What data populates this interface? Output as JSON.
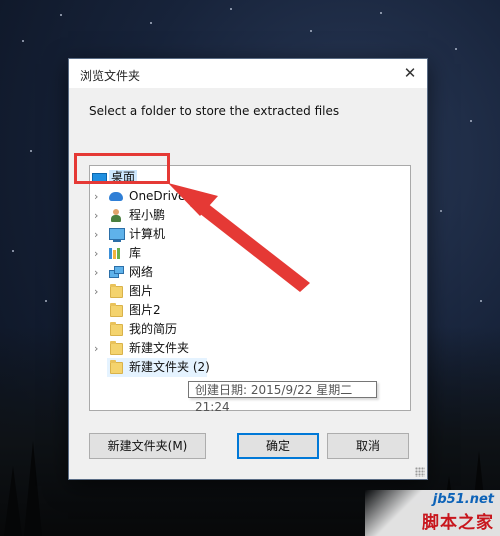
{
  "dialog": {
    "title": "浏览文件夹",
    "close_glyph": "✕",
    "prompt": "Select a folder to store the extracted files"
  },
  "tree": {
    "items": [
      {
        "label": "桌面",
        "icon": "desktop-icon",
        "expandable": false,
        "state": "selected"
      },
      {
        "label": "OneDrive",
        "icon": "onedrive-icon",
        "expandable": true
      },
      {
        "label": "程小鹏",
        "icon": "user-icon",
        "expandable": true
      },
      {
        "label": "计算机",
        "icon": "computer-icon",
        "expandable": true
      },
      {
        "label": "库",
        "icon": "library-icon",
        "expandable": true
      },
      {
        "label": "网络",
        "icon": "network-icon",
        "expandable": true
      },
      {
        "label": "图片",
        "icon": "folder-icon",
        "expandable": true
      },
      {
        "label": "图片2",
        "icon": "folder-icon",
        "expandable": false
      },
      {
        "label": "我的简历",
        "icon": "folder-icon",
        "expandable": false
      },
      {
        "label": "新建文件夹",
        "icon": "folder-icon",
        "expandable": true
      },
      {
        "label": "新建文件夹 (2)",
        "icon": "folder-icon",
        "expandable": false,
        "state": "hover"
      }
    ],
    "expand_glyph": "›"
  },
  "tooltip": {
    "text": "创建日期: 2015/9/22 星期二 21:24"
  },
  "buttons": {
    "new_folder": "新建文件夹(M)",
    "ok": "确定",
    "cancel": "取消"
  },
  "annotation": {
    "color": "#e53935"
  },
  "watermark": {
    "url": "jb51.net",
    "name": "脚本之家"
  },
  "colors": {
    "accent": "#0078d7",
    "selection": "#cde8ff",
    "hover": "#e5f3ff"
  }
}
